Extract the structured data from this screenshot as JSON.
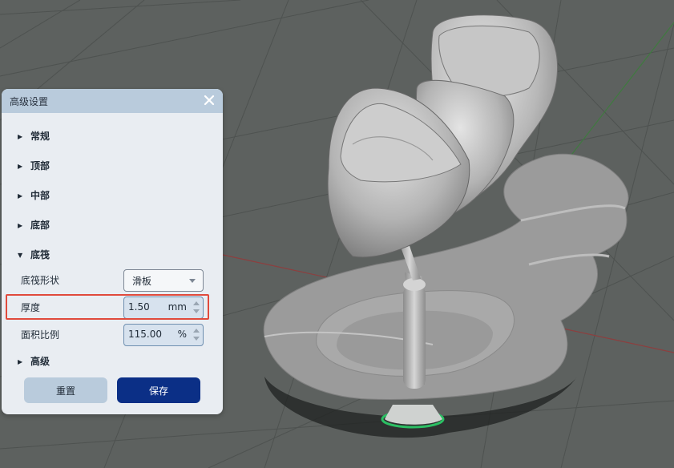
{
  "panel": {
    "title": "高级设置",
    "sections": {
      "general": "常规",
      "top": "顶部",
      "middle": "中部",
      "bottom": "底部",
      "base": "底筏",
      "advanced": "高级"
    },
    "base_shape": {
      "label": "底筏形状",
      "value": "滑板"
    },
    "thickness": {
      "label": "厚度",
      "value": "1.50",
      "unit": "mm"
    },
    "area_ratio": {
      "label": "面积比例",
      "value": "115.00",
      "unit": "%"
    },
    "buttons": {
      "reset": "重置",
      "save": "保存"
    }
  },
  "colors": {
    "viewport_bg": "#5d615f",
    "panel_bg": "#e9edf2",
    "header_bg": "#b9cbdc",
    "save_button": "#0b2f86",
    "highlight": "#e04a3c"
  }
}
